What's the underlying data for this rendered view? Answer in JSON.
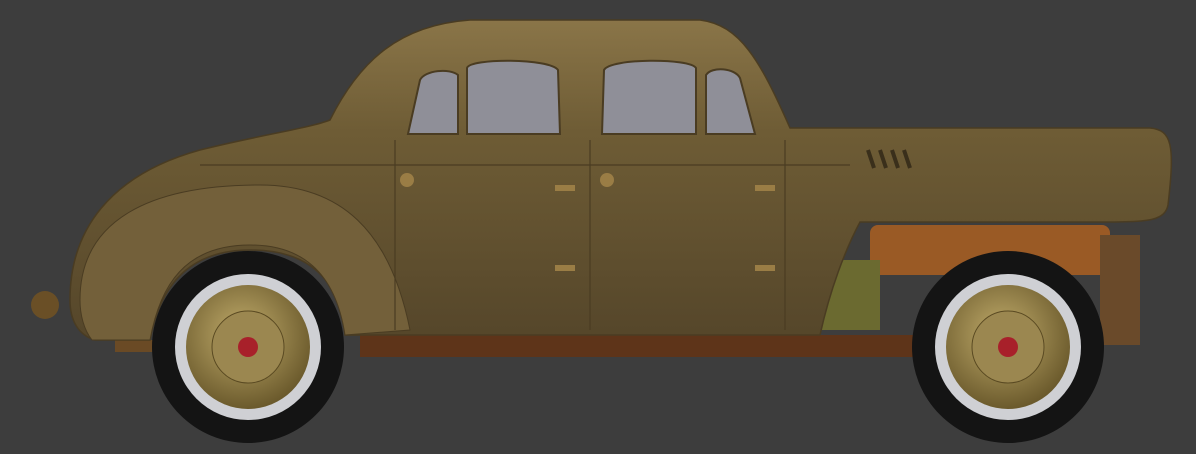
{
  "viewport": {
    "background_color": "#3d3d3d",
    "subject": "vintage-sedan-side-view"
  },
  "colors": {
    "body": "#6e5c35",
    "body_highlight": "#8a7548",
    "body_shadow": "#4f4124",
    "window": "#8f8f98",
    "chassis": "#6a3a1c",
    "tank": "#9a5a25",
    "tire": "#141414",
    "whitewall": "#cfd0d4",
    "rim": "#8d7a45",
    "hub_cap": "#a8202a"
  }
}
